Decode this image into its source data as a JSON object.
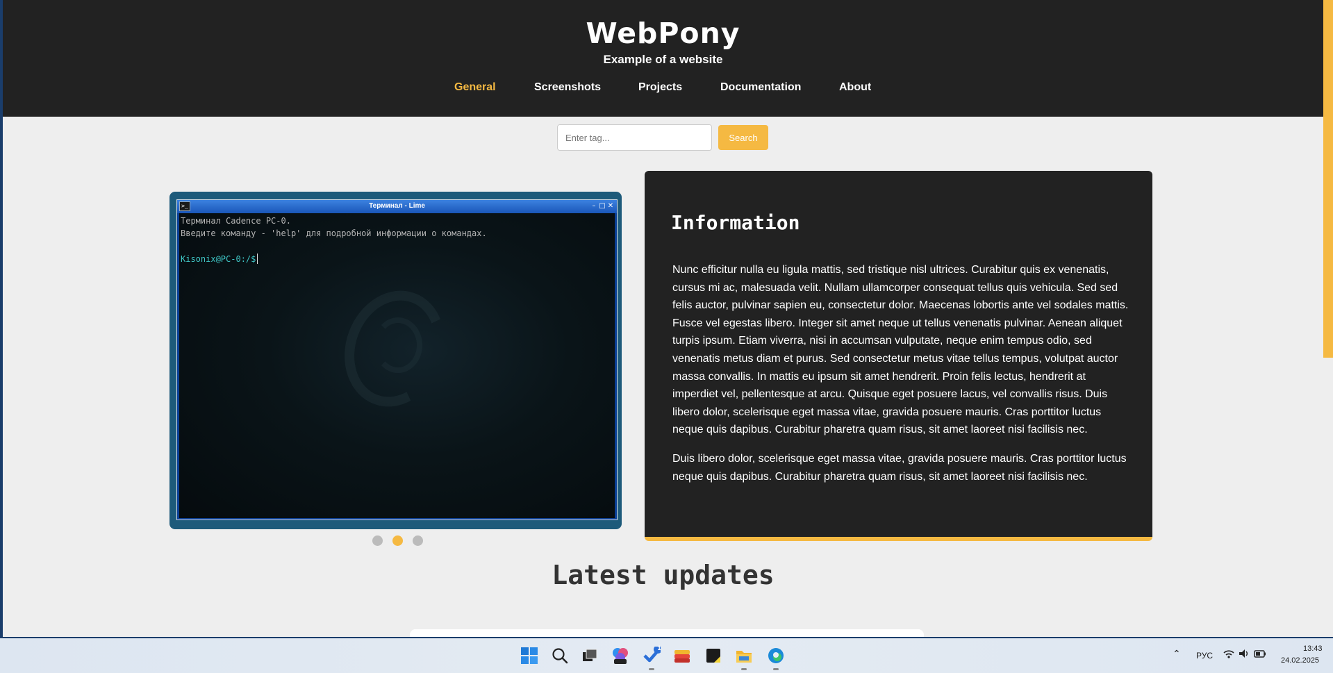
{
  "site": {
    "title": "WebPony",
    "subtitle": "Example of a website"
  },
  "nav": [
    {
      "label": "General",
      "active": true
    },
    {
      "label": "Screenshots",
      "active": false
    },
    {
      "label": "Projects",
      "active": false
    },
    {
      "label": "Documentation",
      "active": false
    },
    {
      "label": "About",
      "active": false
    }
  ],
  "search": {
    "placeholder": "Enter tag...",
    "button": "Search"
  },
  "carousel": {
    "active_slide": 2,
    "slide_count": 3,
    "terminal": {
      "window_title": "Терминал - Lime",
      "line1": "Терминал Cadence PC-0.",
      "line2": "Введите команду - 'help' для подробной информации о командах.",
      "prompt": "Kisonix@PC-0:/$"
    }
  },
  "info": {
    "heading": "Information",
    "paragraph1": "Nunc efficitur nulla eu ligula mattis, sed tristique nisl ultrices. Curabitur quis ex venenatis, cursus mi ac, malesuada velit. Nullam ullamcorper consequat tellus quis vehicula. Sed sed felis auctor, pulvinar sapien eu, consectetur dolor. Maecenas lobortis ante vel sodales mattis. Fusce vel egestas libero. Integer sit amet neque ut tellus venenatis pulvinar. Aenean aliquet turpis ipsum. Etiam viverra, nisi in accumsan vulputate, neque enim tempus odio, sed venenatis metus diam et purus. Sed consectetur metus vitae tellus tempus, volutpat auctor massa convallis. In mattis eu ipsum sit amet hendrerit. Proin felis lectus, hendrerit at imperdiet vel, pellentesque at arcu. Quisque eget posuere lacus, vel convallis risus. Duis libero dolor, scelerisque eget massa vitae, gravida posuere mauris. Cras porttitor luctus neque quis dapibus. Curabitur pharetra quam risus, sit amet laoreet nisi facilisis nec.",
    "paragraph2": "Duis libero dolor, scelerisque eget massa vitae, gravida posuere mauris. Cras porttitor luctus neque quis dapibus. Curabitur pharetra quam risus, sit amet laoreet nisi facilisis nec."
  },
  "latest": {
    "heading": "Latest updates"
  },
  "taskbar": {
    "apps": [
      "start-icon",
      "search-icon",
      "task-view-icon",
      "m365-icon",
      "todo-icon",
      "stacks-icon",
      "sticky-notes-icon",
      "file-explorer-icon",
      "edge-icon"
    ],
    "todo_badge": "1",
    "language": "РУС",
    "time": "13:43",
    "date": "24.02.2025"
  },
  "colors": {
    "accent": "#f5b942",
    "header_bg": "#222222",
    "page_bg": "#eeeeee",
    "terminal_frame": "#1d5a7a"
  }
}
